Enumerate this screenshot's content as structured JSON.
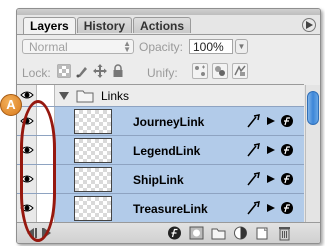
{
  "tabs": [
    {
      "label": "Layers",
      "active": true
    },
    {
      "label": "History",
      "active": false
    },
    {
      "label": "Actions",
      "active": false
    }
  ],
  "blend_mode": {
    "value": "Normal"
  },
  "opacity": {
    "label": "Opacity:",
    "value": "100%"
  },
  "lock": {
    "label": "Lock:"
  },
  "unify": {
    "label": "Unify:"
  },
  "group": {
    "name": "Links"
  },
  "layers": [
    {
      "name": "JourneyLink"
    },
    {
      "name": "LegendLink"
    },
    {
      "name": "ShipLink"
    },
    {
      "name": "TreasureLink"
    }
  ],
  "callout": {
    "letter": "A"
  },
  "colors": {
    "selection": "#b2cbe9",
    "callout": "#e08a2a",
    "highlight_ring": "#96180f"
  }
}
